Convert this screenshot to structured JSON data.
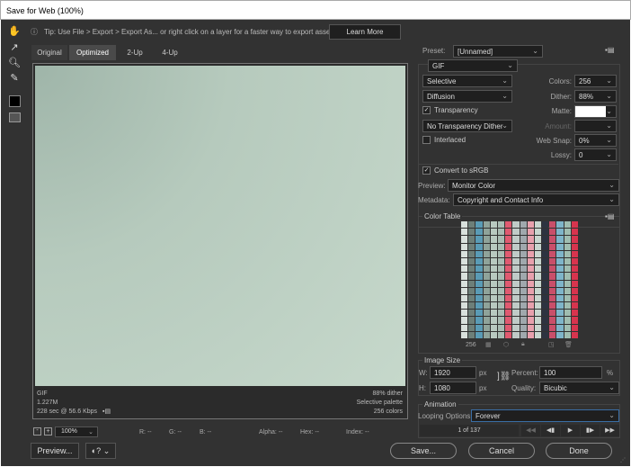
{
  "title": "Save for Web (100%)",
  "tip": "Tip: Use File > Export > Export As...  or right click on a layer for a faster way to export assets",
  "learn_more": "Learn More",
  "tabs": [
    "Original",
    "Optimized",
    "2-Up",
    "4-Up"
  ],
  "info_left": [
    "GIF",
    "1.227M",
    "228 sec @ 56.6 Kbps"
  ],
  "info_right": [
    "88% dither",
    "Selective palette",
    "256 colors"
  ],
  "zoom": "100%",
  "readouts": {
    "r": "R: --",
    "g": "G: --",
    "b": "B: --",
    "alpha": "Alpha: --",
    "hex": "Hex: --",
    "index": "Index: --"
  },
  "preview_btn": "Preview...",
  "preset": {
    "label": "Preset:",
    "value": "[Unnamed]"
  },
  "format": "GIF",
  "reduction": "Selective",
  "dither_algo": "Diffusion",
  "transparency": {
    "label": "Transparency",
    "checked": true
  },
  "trans_dither": "No Transparency Dither",
  "interlaced": {
    "label": "Interlaced",
    "checked": false
  },
  "colors": {
    "label": "Colors:",
    "value": "256"
  },
  "dither": {
    "label": "Dither:",
    "value": "88%"
  },
  "matte": {
    "label": "Matte:"
  },
  "amount": {
    "label": "Amount:",
    "value": ""
  },
  "websnap": {
    "label": "Web Snap:",
    "value": "0%"
  },
  "lossy": {
    "label": "Lossy:",
    "value": "0"
  },
  "srgb": {
    "label": "Convert to sRGB",
    "checked": true
  },
  "preview": {
    "label": "Preview:",
    "value": "Monitor Color"
  },
  "metadata": {
    "label": "Metadata:",
    "value": "Copyright and Contact Info"
  },
  "color_table": {
    "title": "Color Table",
    "count": "256",
    "palette": [
      "#b8c9c0",
      "#a9bcb3",
      "#c9d6cf",
      "#8fa39a",
      "#d8e0dc",
      "#6d7f79",
      "#e05a70",
      "#d8344e",
      "#c94f6a",
      "#7fb5c9",
      "#5a9bb5",
      "#2d3340",
      "#a0a8ad",
      "#e8a0ad",
      "#9fbdb0",
      "#c0cbc7"
    ]
  },
  "image_size": {
    "title": "Image Size",
    "w_label": "W:",
    "w": "1920",
    "h_label": "H:",
    "h": "1080",
    "unit": "px",
    "percent_label": "Percent:",
    "percent": "100",
    "pct": "%",
    "quality_label": "Quality:",
    "quality": "Bicubic"
  },
  "animation": {
    "title": "Animation",
    "looping_label": "Looping Options:",
    "looping": "Forever",
    "frame": "1 of 137"
  },
  "buttons": {
    "save": "Save...",
    "cancel": "Cancel",
    "done": "Done"
  }
}
